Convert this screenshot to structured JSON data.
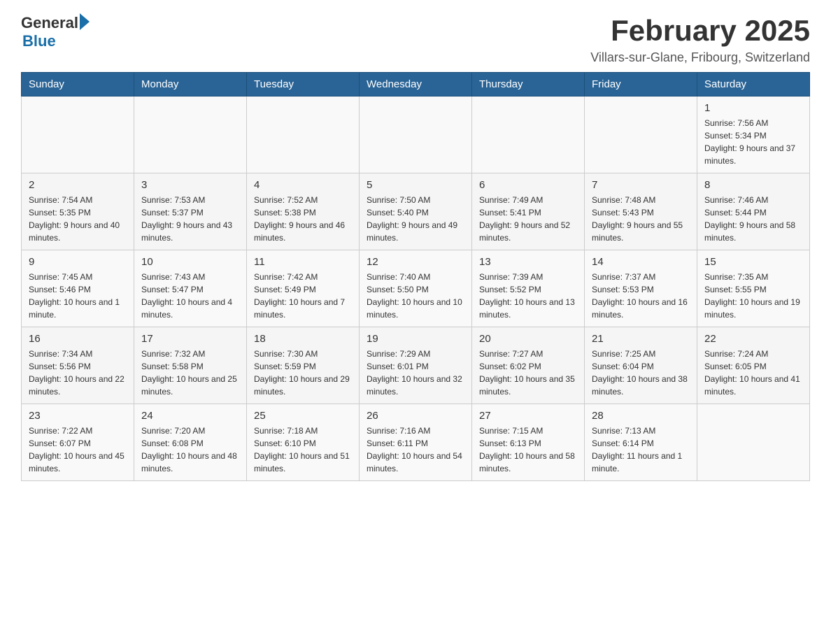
{
  "header": {
    "logo_general": "General",
    "logo_blue": "Blue",
    "title": "February 2025",
    "subtitle": "Villars-sur-Glane, Fribourg, Switzerland"
  },
  "weekdays": [
    "Sunday",
    "Monday",
    "Tuesday",
    "Wednesday",
    "Thursday",
    "Friday",
    "Saturday"
  ],
  "weeks": [
    [
      {
        "day": "",
        "info": ""
      },
      {
        "day": "",
        "info": ""
      },
      {
        "day": "",
        "info": ""
      },
      {
        "day": "",
        "info": ""
      },
      {
        "day": "",
        "info": ""
      },
      {
        "day": "",
        "info": ""
      },
      {
        "day": "1",
        "info": "Sunrise: 7:56 AM\nSunset: 5:34 PM\nDaylight: 9 hours and 37 minutes."
      }
    ],
    [
      {
        "day": "2",
        "info": "Sunrise: 7:54 AM\nSunset: 5:35 PM\nDaylight: 9 hours and 40 minutes."
      },
      {
        "day": "3",
        "info": "Sunrise: 7:53 AM\nSunset: 5:37 PM\nDaylight: 9 hours and 43 minutes."
      },
      {
        "day": "4",
        "info": "Sunrise: 7:52 AM\nSunset: 5:38 PM\nDaylight: 9 hours and 46 minutes."
      },
      {
        "day": "5",
        "info": "Sunrise: 7:50 AM\nSunset: 5:40 PM\nDaylight: 9 hours and 49 minutes."
      },
      {
        "day": "6",
        "info": "Sunrise: 7:49 AM\nSunset: 5:41 PM\nDaylight: 9 hours and 52 minutes."
      },
      {
        "day": "7",
        "info": "Sunrise: 7:48 AM\nSunset: 5:43 PM\nDaylight: 9 hours and 55 minutes."
      },
      {
        "day": "8",
        "info": "Sunrise: 7:46 AM\nSunset: 5:44 PM\nDaylight: 9 hours and 58 minutes."
      }
    ],
    [
      {
        "day": "9",
        "info": "Sunrise: 7:45 AM\nSunset: 5:46 PM\nDaylight: 10 hours and 1 minute."
      },
      {
        "day": "10",
        "info": "Sunrise: 7:43 AM\nSunset: 5:47 PM\nDaylight: 10 hours and 4 minutes."
      },
      {
        "day": "11",
        "info": "Sunrise: 7:42 AM\nSunset: 5:49 PM\nDaylight: 10 hours and 7 minutes."
      },
      {
        "day": "12",
        "info": "Sunrise: 7:40 AM\nSunset: 5:50 PM\nDaylight: 10 hours and 10 minutes."
      },
      {
        "day": "13",
        "info": "Sunrise: 7:39 AM\nSunset: 5:52 PM\nDaylight: 10 hours and 13 minutes."
      },
      {
        "day": "14",
        "info": "Sunrise: 7:37 AM\nSunset: 5:53 PM\nDaylight: 10 hours and 16 minutes."
      },
      {
        "day": "15",
        "info": "Sunrise: 7:35 AM\nSunset: 5:55 PM\nDaylight: 10 hours and 19 minutes."
      }
    ],
    [
      {
        "day": "16",
        "info": "Sunrise: 7:34 AM\nSunset: 5:56 PM\nDaylight: 10 hours and 22 minutes."
      },
      {
        "day": "17",
        "info": "Sunrise: 7:32 AM\nSunset: 5:58 PM\nDaylight: 10 hours and 25 minutes."
      },
      {
        "day": "18",
        "info": "Sunrise: 7:30 AM\nSunset: 5:59 PM\nDaylight: 10 hours and 29 minutes."
      },
      {
        "day": "19",
        "info": "Sunrise: 7:29 AM\nSunset: 6:01 PM\nDaylight: 10 hours and 32 minutes."
      },
      {
        "day": "20",
        "info": "Sunrise: 7:27 AM\nSunset: 6:02 PM\nDaylight: 10 hours and 35 minutes."
      },
      {
        "day": "21",
        "info": "Sunrise: 7:25 AM\nSunset: 6:04 PM\nDaylight: 10 hours and 38 minutes."
      },
      {
        "day": "22",
        "info": "Sunrise: 7:24 AM\nSunset: 6:05 PM\nDaylight: 10 hours and 41 minutes."
      }
    ],
    [
      {
        "day": "23",
        "info": "Sunrise: 7:22 AM\nSunset: 6:07 PM\nDaylight: 10 hours and 45 minutes."
      },
      {
        "day": "24",
        "info": "Sunrise: 7:20 AM\nSunset: 6:08 PM\nDaylight: 10 hours and 48 minutes."
      },
      {
        "day": "25",
        "info": "Sunrise: 7:18 AM\nSunset: 6:10 PM\nDaylight: 10 hours and 51 minutes."
      },
      {
        "day": "26",
        "info": "Sunrise: 7:16 AM\nSunset: 6:11 PM\nDaylight: 10 hours and 54 minutes."
      },
      {
        "day": "27",
        "info": "Sunrise: 7:15 AM\nSunset: 6:13 PM\nDaylight: 10 hours and 58 minutes."
      },
      {
        "day": "28",
        "info": "Sunrise: 7:13 AM\nSunset: 6:14 PM\nDaylight: 11 hours and 1 minute."
      },
      {
        "day": "",
        "info": ""
      }
    ]
  ]
}
